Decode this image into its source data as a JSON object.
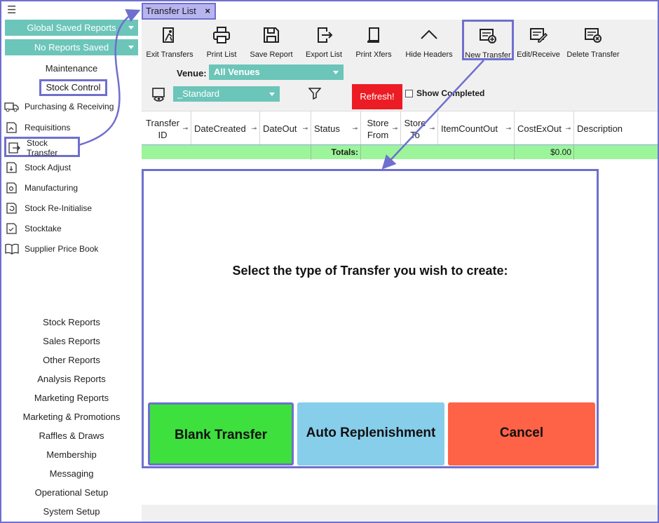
{
  "sidebar": {
    "dropdowns": [
      "Global Saved Reports",
      "No Reports Saved"
    ],
    "maintenance": "Maintenance",
    "stock_control": "Stock Control",
    "items": [
      {
        "label": "Purchasing & Receiving",
        "icon": "truck-icon"
      },
      {
        "label": "Requisitions",
        "icon": "requisition-icon"
      },
      {
        "label": "Stock Transfer",
        "icon": "transfer-icon"
      },
      {
        "label": "Stock Adjust",
        "icon": "adjust-icon"
      },
      {
        "label": "Manufacturing",
        "icon": "manufacturing-icon"
      },
      {
        "label": "Stock Re-Initialise",
        "icon": "reinitialise-icon"
      },
      {
        "label": "Stocktake",
        "icon": "stocktake-icon"
      },
      {
        "label": "Supplier Price Book",
        "icon": "book-icon"
      }
    ],
    "reports": [
      "Stock Reports",
      "Sales Reports",
      "Other Reports",
      "Analysis Reports",
      "Marketing Reports",
      "Marketing & Promotions",
      "Raffles & Draws",
      "Membership",
      "Messaging",
      "Operational Setup",
      "System Setup"
    ]
  },
  "tab": {
    "label": "Transfer List",
    "close": "×"
  },
  "toolbar": [
    {
      "label": "Exit Transfers",
      "icon": "exit-icon"
    },
    {
      "label": "Print List",
      "icon": "printer-icon"
    },
    {
      "label": "Save Report",
      "icon": "save-icon"
    },
    {
      "label": "Export List",
      "icon": "export-icon"
    },
    {
      "label": "Print Xfers",
      "icon": "print-xfers-icon"
    },
    {
      "label": "Hide Headers",
      "icon": "chevron-up-icon"
    },
    {
      "label": "New Transfer",
      "icon": "new-transfer-icon"
    },
    {
      "label": "Edit/Receive",
      "icon": "edit-receive-icon"
    },
    {
      "label": "Delete Transfer",
      "icon": "delete-transfer-icon"
    }
  ],
  "filters": {
    "venue_label": "Venue:",
    "venue_value": "All Venues",
    "layout_value": "_Standard",
    "refresh": "Refresh!",
    "show_completed": "Show Completed"
  },
  "grid": {
    "columns": [
      "Transfer ID",
      "DateCreated",
      "DateOut",
      "Status",
      "Store From",
      "Store To",
      "ItemCountOut",
      "CostExOut",
      "Description"
    ],
    "totals_label": "Totals:",
    "totals_cost": "$0.00"
  },
  "dialog": {
    "prompt": "Select the type of Transfer you wish to create:",
    "buttons": [
      {
        "label": "Blank Transfer",
        "color": "#3ee03e"
      },
      {
        "label": "Auto Replenishment",
        "color": "#87ceeb"
      },
      {
        "label": "Cancel",
        "color": "#ff6347"
      }
    ]
  },
  "colors": {
    "accent": "#6f6fcf",
    "teal": "#6cc5b9",
    "refresh": "#ec1c24",
    "totals": "#9cf59a"
  }
}
